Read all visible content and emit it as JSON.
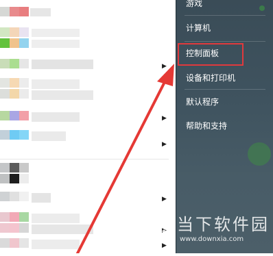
{
  "start_menu": {
    "system_links": [
      {
        "label": "游戏"
      },
      {
        "label": "计算机"
      },
      {
        "label": "控制面板",
        "highlighted": true
      },
      {
        "label": "设备和打印机"
      },
      {
        "label": "默认程序"
      },
      {
        "label": "帮助和支持"
      }
    ],
    "submenu_arrow": "▶",
    "highlight_color": "#e2393c"
  },
  "watermark": {
    "text": "当下软件园",
    "url": "www.downxia.com"
  }
}
